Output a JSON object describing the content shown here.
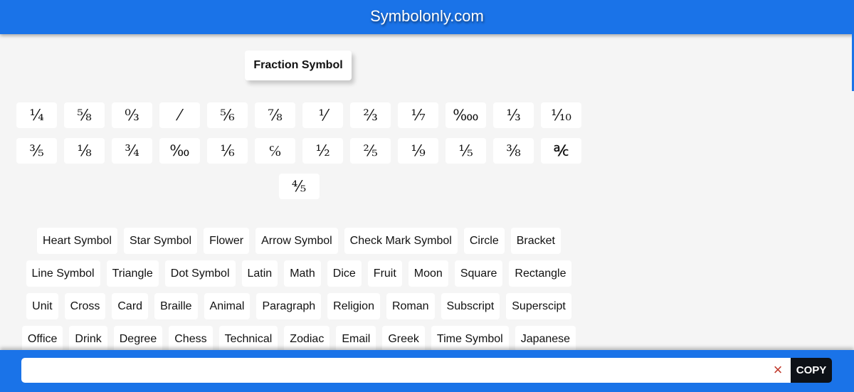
{
  "header": {
    "title": "Symbolonly.com"
  },
  "section": {
    "title": "Fraction Symbol"
  },
  "symbols": [
    "¼",
    "⅝",
    "↉",
    "⁄",
    "⅚",
    "⅞",
    "⅟",
    "⅔",
    "⅐",
    "‱",
    "⅓",
    "⅒",
    "⅗",
    "⅛",
    "¾",
    "‰",
    "⅙",
    "℅",
    "½",
    "⅖",
    "⅑",
    "⅕",
    "⅜",
    "℀",
    "⅘"
  ],
  "categories": [
    "Heart Symbol",
    "Star Symbol",
    "Flower",
    "Arrow Symbol",
    "Check Mark Symbol",
    "Circle",
    "Bracket",
    "Line Symbol",
    "Triangle",
    "Dot Symbol",
    "Latin",
    "Math",
    "Dice",
    "Fruit",
    "Moon",
    "Square",
    "Rectangle",
    "Unit",
    "Cross",
    "Card",
    "Braille",
    "Animal",
    "Paragraph",
    "Religion",
    "Roman",
    "Subscript",
    "Superscipt",
    "Office",
    "Drink",
    "Degree",
    "Chess",
    "Technical",
    "Zodiac",
    "Email",
    "Greek",
    "Time Symbol",
    "Japanese"
  ],
  "footer": {
    "input_value": "",
    "clear_icon": "×",
    "copy_label": "COPY"
  },
  "colors": {
    "brand": "#1a73e8",
    "copy_button": "#0d1117",
    "clear_icon": "#c0392b"
  }
}
